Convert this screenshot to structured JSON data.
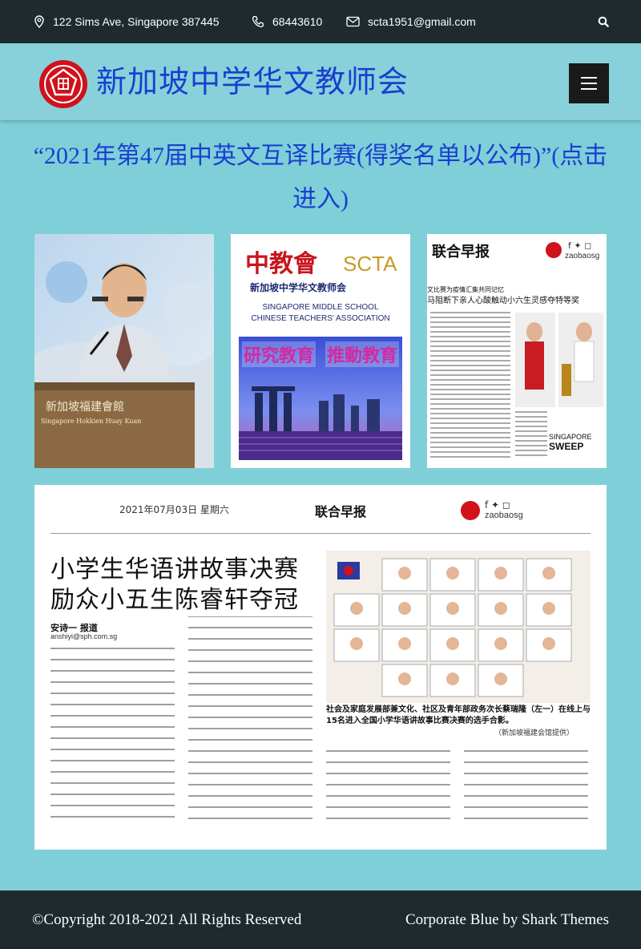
{
  "topbar": {
    "address": "122 Sims Ave, Singapore 387445",
    "phone": "68443610",
    "email": "scta1951@gmail.com"
  },
  "header": {
    "site_title": "新加坡中学华文教师会"
  },
  "post": {
    "title": "“2021年第47届中英文互译比赛(得奖名单以公布)”(点击进入)"
  },
  "gallery": {
    "photo1": {
      "podium_text": "新加坡福建會館",
      "podium_text_en": "Singapore Hokkien Huay Kuan"
    },
    "poster": {
      "logo_cn": "中教會",
      "logo_en": "SCTA",
      "name_cn": "新加坡中学华文教师会",
      "name_en_1": "SINGAPORE MIDDLE SCHOOL",
      "name_en_2": "CHINESE TEACHERS' ASSOCIATION",
      "slogan_1": "研究教育",
      "slogan_2": "推動教育"
    },
    "clip1": {
      "paper": "联合早报",
      "social": "zaobaosg",
      "headline_1": "文比赛为疫情汇集共同记忆",
      "headline_2": "马阻断下亲人心酸触动小六生灵感夺特等奖",
      "badge_1": "SINGAPORE",
      "badge_2": "SWEEP"
    },
    "clip2": {
      "date": "2021年07月03日 星期六",
      "paper": "联合早报",
      "social": "zaobaosg",
      "headline_1": "小学生华语讲故事决赛",
      "headline_2": "励众小五生陈睿轩夺冠",
      "byline": "安诗一  报道",
      "email": "anshiyi@sph.com.sg",
      "caption": "社会及家庭发展部兼文化、社区及青年部政务次长蔡瑞隆（左一）在线上与15名进入全国小学华语讲故事比赛决赛的选手合影。",
      "caption_credit": "（新加坡福建会馆提供）"
    }
  },
  "footer": {
    "copyright": "©Copyright 2018-2021 All Rights Reserved",
    "credit": "Corporate Blue by Shark Themes"
  }
}
